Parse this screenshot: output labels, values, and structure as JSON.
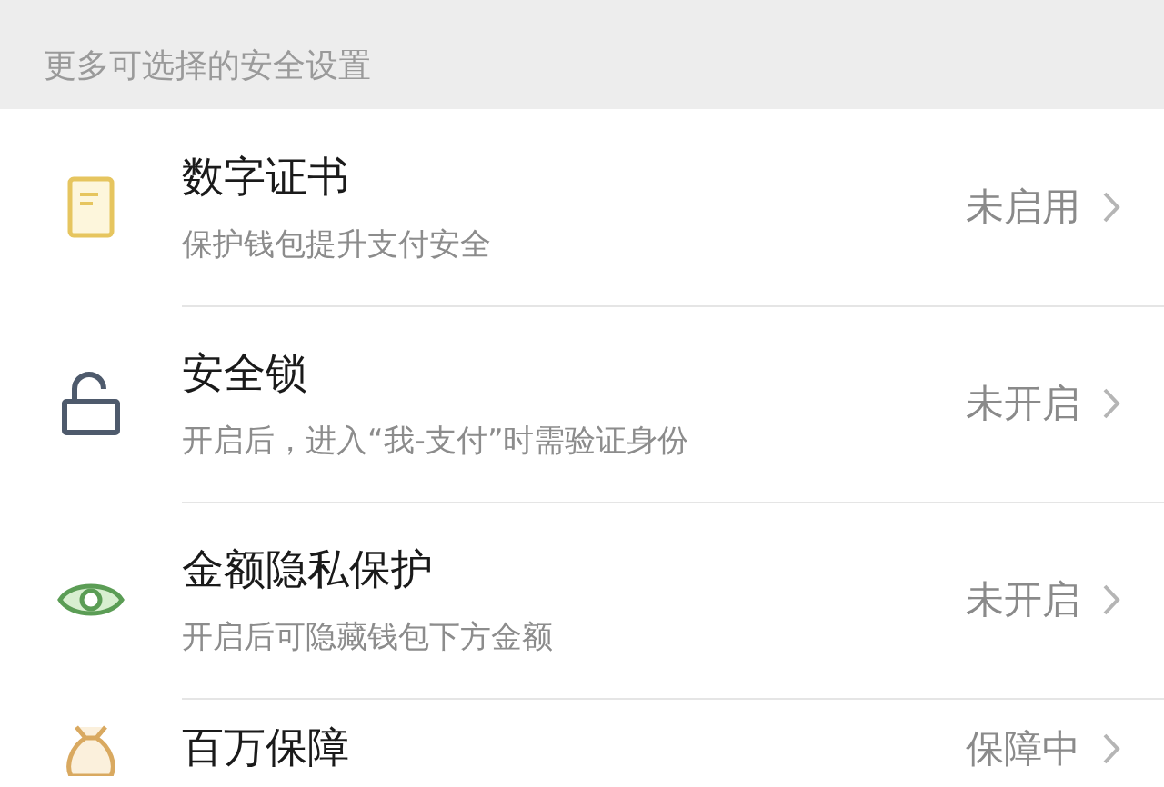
{
  "section_header": "更多可选择的安全设置",
  "items": [
    {
      "title": "数字证书",
      "subtitle": "保护钱包提升支付安全",
      "status": "未启用"
    },
    {
      "title": "安全锁",
      "subtitle": "开启后，进入“我-支付”时需验证身份",
      "status": "未开启"
    },
    {
      "title": "金额隐私保护",
      "subtitle": "开启后可隐藏钱包下方金额",
      "status": "未开启"
    },
    {
      "title": "百万保障",
      "status": "保障中"
    }
  ]
}
